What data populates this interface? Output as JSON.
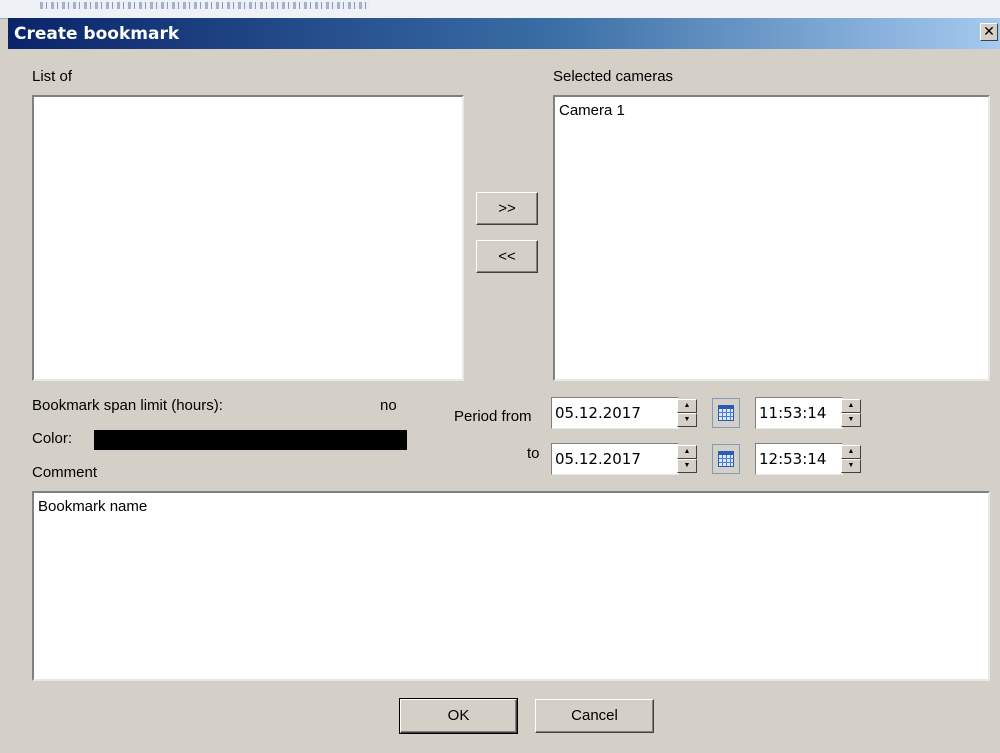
{
  "window": {
    "title": "Create bookmark",
    "close_glyph": "✕"
  },
  "lists": {
    "available_label": "List of",
    "available_items": [],
    "selected_label": "Selected cameras",
    "selected_items": [
      "Camera 1"
    ]
  },
  "transfer": {
    "add_label": ">>",
    "remove_label": "<<"
  },
  "span_limit": {
    "label": "Bookmark span limit (hours):",
    "value": "no"
  },
  "color": {
    "label": "Color:",
    "value": "#000000"
  },
  "period": {
    "from_label": "Period from",
    "to_label": "to",
    "from_date": "05.12.2017",
    "from_time": "11:53:14",
    "to_date": "05.12.2017",
    "to_time": "12:53:14"
  },
  "comment": {
    "label": "Comment",
    "value": "Bookmark name"
  },
  "buttons": {
    "ok": "OK",
    "cancel": "Cancel"
  }
}
